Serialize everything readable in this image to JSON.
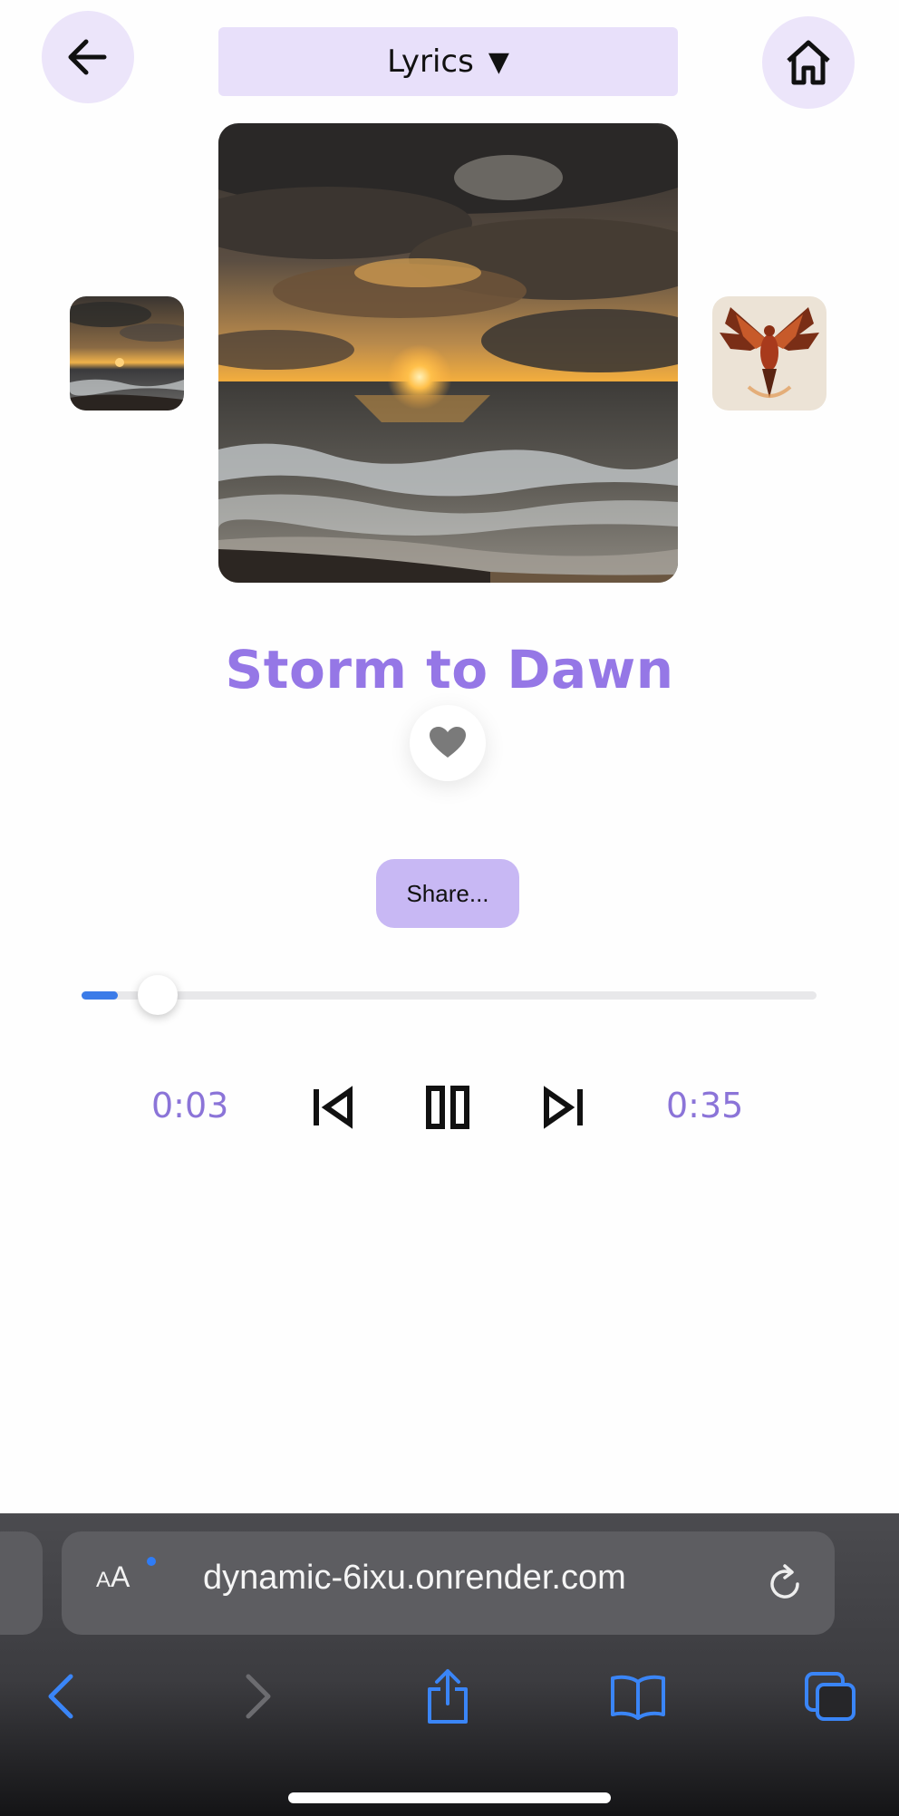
{
  "header": {
    "lyrics_label": "Lyrics",
    "lyrics_caret": "▼"
  },
  "icons": {
    "back": "arrow-left-icon",
    "home": "home-icon",
    "like": "heart-icon"
  },
  "song": {
    "title": "Storm to Dawn",
    "share_label": "Share..."
  },
  "playback": {
    "elapsed": "0:03",
    "total": "0:35",
    "progress_fraction": 0.086
  },
  "browser": {
    "text_size_label_small": "A",
    "text_size_label_large": "A",
    "url": "dynamic-6ixu.onrender.com"
  },
  "colors": {
    "accent_purple": "#9577e6",
    "button_lavender": "#e8e0fa",
    "share_button": "#c8b8f4",
    "progress_blue": "#3b7be8",
    "safari_blue": "#2f7cf6"
  }
}
